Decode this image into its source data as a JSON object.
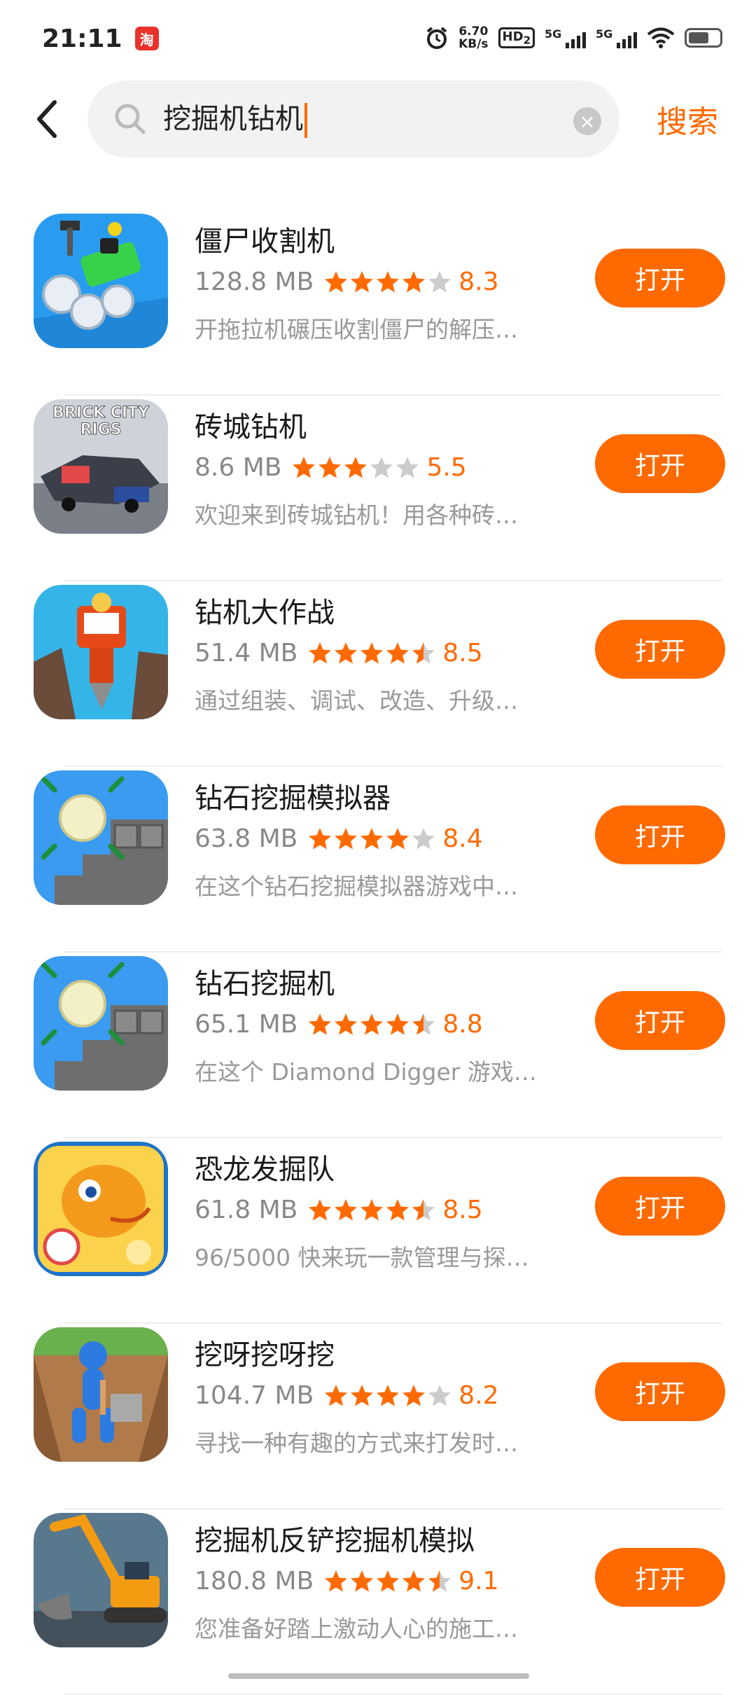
{
  "status_bar": {
    "time": "21:11",
    "app_badge": "淘",
    "net_speed_value": "6.70",
    "net_speed_unit": "KB/s",
    "hd_label": "HD",
    "hd_sub": "2",
    "sim1_label": "5G",
    "sim2_label": "5G",
    "icons": [
      "alarm-icon",
      "hd-icon",
      "signal-icon",
      "signal-icon",
      "wifi-icon",
      "battery-icon"
    ]
  },
  "search": {
    "query": "挖掘机钻机",
    "submit_label": "搜索",
    "back_icon": "chevron-left-icon",
    "search_icon": "magnifier-icon",
    "clear_icon": "close-icon"
  },
  "theme": {
    "accent": "#ff6a00",
    "star_on": "#ff6a00",
    "star_off": "#cccccc"
  },
  "apps": [
    {
      "name": "僵尸收割机",
      "size": "128.8 MB",
      "rating": "8.3",
      "stars": 4.0,
      "description": "开拖拉机碾压收割僵尸的解压…",
      "button": "打开",
      "icon": "zombie-harvester-icon"
    },
    {
      "name": "砖城钻机",
      "size": "8.6 MB",
      "rating": "5.5",
      "stars": 3.0,
      "description": "欢迎来到砖城钻机！用各种砖…",
      "button": "打开",
      "icon": "brick-city-rigs-icon",
      "icon_text": "BRICK CITY RIGS"
    },
    {
      "name": "钻机大作战",
      "size": "51.4 MB",
      "rating": "8.5",
      "stars": 4.5,
      "description": "通过组装、调试、改造、升级…",
      "button": "打开",
      "icon": "drill-tower-icon"
    },
    {
      "name": "钻石挖掘模拟器",
      "size": "63.8 MB",
      "rating": "8.4",
      "stars": 4.0,
      "description": "在这个钻石挖掘模拟器游戏中…",
      "button": "打开",
      "icon": "diamond-drill-icon"
    },
    {
      "name": "钻石挖掘机",
      "size": "65.1 MB",
      "rating": "8.8",
      "stars": 4.5,
      "description": "在这个 Diamond Digger 游戏…",
      "button": "打开",
      "icon": "diamond-drill-icon"
    },
    {
      "name": "恐龙发掘队",
      "size": "61.8 MB",
      "rating": "8.5",
      "stars": 4.5,
      "description": "96/5000  快来玩一款管理与探…",
      "button": "打开",
      "icon": "dinosaur-icon"
    },
    {
      "name": "挖呀挖呀挖",
      "size": "104.7 MB",
      "rating": "8.2",
      "stars": 4.0,
      "description": "寻找一种有趣的方式来打发时…",
      "button": "打开",
      "icon": "digging-man-icon"
    },
    {
      "name": "挖掘机反铲挖掘机模拟",
      "size": "180.8 MB",
      "rating": "9.1",
      "stars": 4.5,
      "description": "您准备好踏上激动人心的施工…",
      "button": "打开",
      "icon": "excavator-icon"
    }
  ]
}
